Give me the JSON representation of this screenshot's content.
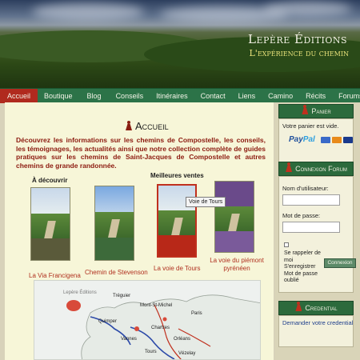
{
  "brand": {
    "title": "Lepère Éditions",
    "tagline": "L'expérience du chemin"
  },
  "nav": {
    "items": [
      "Accueil",
      "Boutique",
      "Blog",
      "Conseils",
      "Itinéraires",
      "Contact",
      "Liens",
      "Camino",
      "Récits",
      "Forums"
    ],
    "active": "Accueil"
  },
  "main": {
    "title": "Accueil",
    "intro": "Découvrez les informations sur les chemins de Compostelle, les conseils, les témoignages, les actualités ainsi que notre collection complète de guides pratiques sur les chemins de Saint-Jacques de Compostelle et autres chemins de grande randonnée.",
    "discover_label": "À découvrir",
    "bestsellers_label": "Meilleures ventes",
    "books": [
      {
        "caption": "La Via Francigena"
      },
      {
        "caption": "Chemin de Stevenson"
      },
      {
        "caption": "La voie de Tours"
      },
      {
        "caption": "La voie du piémont pyrénéen"
      }
    ],
    "tooltip": "Voie de Tours",
    "map": {
      "logo": "Lepère Éditions",
      "labels": [
        "Tréguier",
        "Mont-St-Michel",
        "Paris",
        "Quimper",
        "Vannes",
        "Chartres",
        "Tours",
        "Vézelay",
        "Orléans"
      ]
    }
  },
  "sidebar": {
    "cart": {
      "title": "Panier",
      "empty_text": "Votre panier est vide.",
      "paypal_a": "Pay",
      "paypal_b": "Pal"
    },
    "login": {
      "title": "Connexion Forum",
      "username_label": "Nom d'utilisateur:",
      "password_label": "Mot de passe:",
      "remember_label": "Se rappeler de moi S'enregistrer Mot de passe oublié",
      "button_label": "Connexion"
    },
    "credential": {
      "title": "Credential",
      "text": "Demander votre credential"
    }
  },
  "colors": {
    "nav_bg": "#2c7348",
    "nav_active": "#b02a1e",
    "accent_red": "#8c1a0f",
    "widget_head": "#2c6a3c"
  }
}
